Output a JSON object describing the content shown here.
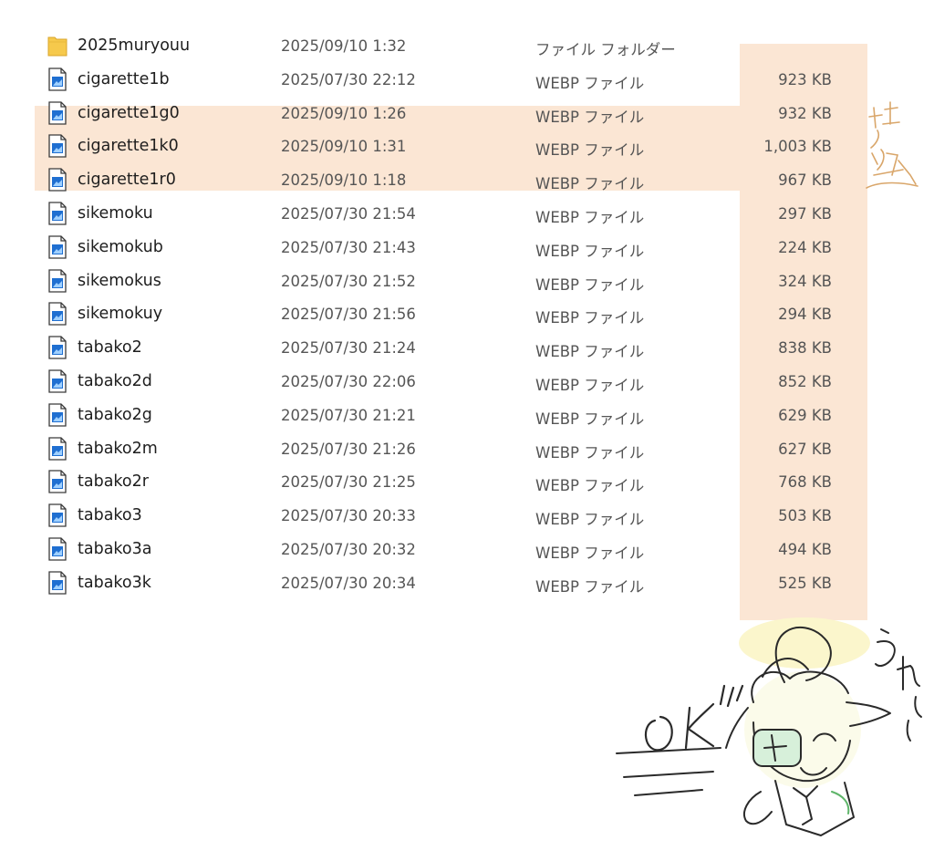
{
  "files": [
    {
      "name": "2025muryouu",
      "date": "2025/09/10 1:32",
      "type": "ファイル フォルダー",
      "size": "",
      "icon": "folder-icon"
    },
    {
      "name": "cigarette1b",
      "date": "2025/07/30 22:12",
      "type": "WEBP ファイル",
      "size": "923 KB",
      "icon": "image-file-icon"
    },
    {
      "name": "cigarette1g0",
      "date": "2025/09/10 1:26",
      "type": "WEBP ファイル",
      "size": "932 KB",
      "icon": "image-file-icon"
    },
    {
      "name": "cigarette1k0",
      "date": "2025/09/10 1:31",
      "type": "WEBP ファイル",
      "size": "1,003 KB",
      "icon": "image-file-icon"
    },
    {
      "name": "cigarette1r0",
      "date": "2025/09/10 1:18",
      "type": "WEBP ファイル",
      "size": "967 KB",
      "icon": "image-file-icon"
    },
    {
      "name": "sikemoku",
      "date": "2025/07/30 21:54",
      "type": "WEBP ファイル",
      "size": "297 KB",
      "icon": "image-file-icon"
    },
    {
      "name": "sikemokub",
      "date": "2025/07/30 21:43",
      "type": "WEBP ファイル",
      "size": "224 KB",
      "icon": "image-file-icon"
    },
    {
      "name": "sikemokus",
      "date": "2025/07/30 21:52",
      "type": "WEBP ファイル",
      "size": "324 KB",
      "icon": "image-file-icon"
    },
    {
      "name": "sikemokuy",
      "date": "2025/07/30 21:56",
      "type": "WEBP ファイル",
      "size": "294 KB",
      "icon": "image-file-icon"
    },
    {
      "name": "tabako2",
      "date": "2025/07/30 21:24",
      "type": "WEBP ファイル",
      "size": "838 KB",
      "icon": "image-file-icon"
    },
    {
      "name": "tabako2d",
      "date": "2025/07/30 22:06",
      "type": "WEBP ファイル",
      "size": "852 KB",
      "icon": "image-file-icon"
    },
    {
      "name": "tabako2g",
      "date": "2025/07/30 21:21",
      "type": "WEBP ファイル",
      "size": "629 KB",
      "icon": "image-file-icon"
    },
    {
      "name": "tabako2m",
      "date": "2025/07/30 21:26",
      "type": "WEBP ファイル",
      "size": "627 KB",
      "icon": "image-file-icon"
    },
    {
      "name": "tabako2r",
      "date": "2025/07/30 21:25",
      "type": "WEBP ファイル",
      "size": "768 KB",
      "icon": "image-file-icon"
    },
    {
      "name": "tabako3",
      "date": "2025/07/30 20:33",
      "type": "WEBP ファイル",
      "size": "503 KB",
      "icon": "image-file-icon"
    },
    {
      "name": "tabako3a",
      "date": "2025/07/30 20:32",
      "type": "WEBP ファイル",
      "size": "494 KB",
      "icon": "image-file-icon"
    },
    {
      "name": "tabako3k",
      "date": "2025/07/30 20:34",
      "type": "WEBP ファイル",
      "size": "525 KB",
      "icon": "image-file-icon"
    }
  ],
  "annotations": {
    "side_note": "喫煙",
    "ok_text": "OK",
    "happy_text": "うれしい",
    "highlight_color": "#fbe6d4"
  }
}
